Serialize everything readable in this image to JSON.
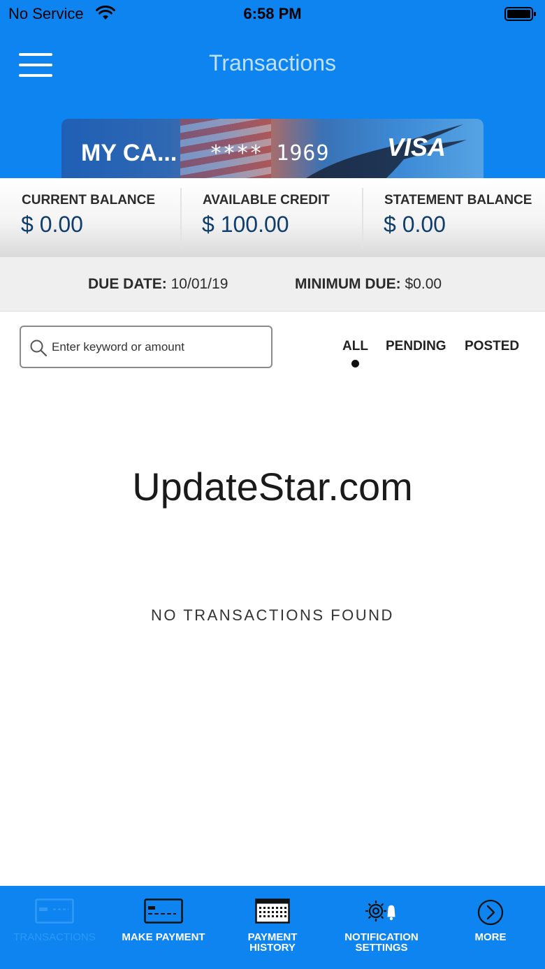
{
  "status_bar": {
    "carrier": "No Service",
    "time": "6:58 PM"
  },
  "header": {
    "title": "Transactions"
  },
  "card": {
    "name": "MY CA...",
    "number": "**** 1969",
    "brand": "VISA"
  },
  "balances": [
    {
      "label": "CURRENT BALANCE",
      "value": "$ 0.00"
    },
    {
      "label": "AVAILABLE CREDIT",
      "value": "$ 100.00"
    },
    {
      "label": "STATEMENT BALANCE",
      "value": "$ 0.00"
    }
  ],
  "due": {
    "due_date_label": "DUE DATE:",
    "due_date_value": "10/01/19",
    "minimum_due_label": "MINIMUM DUE:",
    "minimum_due_value": "$0.00"
  },
  "search": {
    "placeholder": "Enter keyword or amount",
    "value": ""
  },
  "filters": {
    "tabs": [
      "ALL",
      "PENDING",
      "POSTED"
    ],
    "selected": "ALL"
  },
  "watermark": "UpdateStar.com",
  "empty_message": "NO TRANSACTIONS FOUND",
  "bottom_nav": {
    "items": [
      {
        "label": "TRANSACTIONS",
        "icon": "card-icon",
        "active": true
      },
      {
        "label": "MAKE PAYMENT",
        "icon": "payment-card-icon",
        "active": false
      },
      {
        "label": "PAYMENT HISTORY",
        "line1": "PAYMENT",
        "line2": "HISTORY",
        "icon": "calendar-icon",
        "active": false
      },
      {
        "label": "NOTIFICATION SETTINGS",
        "line1": "NOTIFICATION",
        "line2": "SETTINGS",
        "icon": "gear-bell-icon",
        "active": false
      },
      {
        "label": "MORE",
        "icon": "chevron-right-circle-icon",
        "active": false
      }
    ]
  },
  "colors": {
    "brand_blue": "#0d84f0",
    "title_text": "#bfe0ff",
    "balance_value": "#0f3d6e",
    "active_nav": "#2a9af8"
  }
}
